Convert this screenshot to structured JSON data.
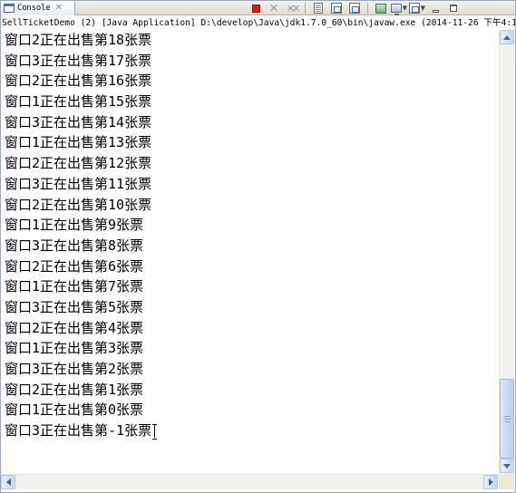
{
  "view": {
    "tab_label": "Console",
    "tab_close_glyph": "✕",
    "description": "SellTicketDemo (2) [Java Application] D:\\develop\\Java\\jdk1.7.0_60\\bin\\javaw.exe (2014-11-26 下午4:1"
  },
  "toolbar": {
    "icons": [
      "terminate-icon",
      "remove-launch-icon",
      "remove-all-terminated-icon",
      "clear-console-icon",
      "scroll-lock-icon",
      "word-wrap-icon",
      "pin-console-icon",
      "display-selected-console-icon",
      "open-console-icon",
      "minimize-icon",
      "maximize-icon"
    ]
  },
  "console": {
    "lines": [
      "窗口2正在出售第18张票",
      "窗口3正在出售第17张票",
      "窗口2正在出售第16张票",
      "窗口1正在出售第15张票",
      "窗口3正在出售第14张票",
      "窗口1正在出售第13张票",
      "窗口2正在出售第12张票",
      "窗口3正在出售第11张票",
      "窗口2正在出售第10张票",
      "窗口1正在出售第9张票",
      "窗口3正在出售第8张票",
      "窗口2正在出售第6张票",
      "窗口1正在出售第7张票",
      "窗口3正在出售第5张票",
      "窗口2正在出售第4张票",
      "窗口1正在出售第3张票",
      "窗口3正在出售第2张票",
      "窗口2正在出售第1张票",
      "窗口1正在出售第0张票",
      "窗口3正在出售第-1张票"
    ]
  },
  "colors": {
    "terminate": "#d22020",
    "scrollbar_thumb": "#b9cdf1",
    "text": "#000000"
  }
}
